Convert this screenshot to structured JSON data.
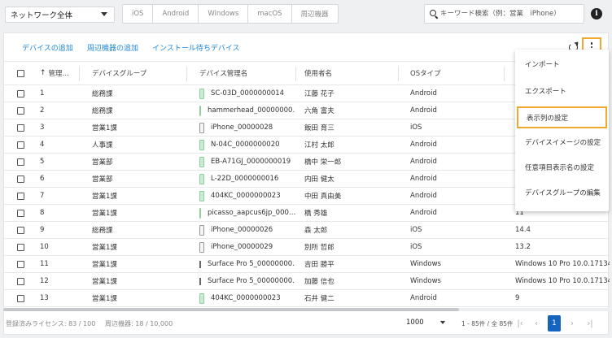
{
  "topbar": {
    "network_select": "ネットワーク全体",
    "os_filters": [
      "iOS",
      "Android",
      "Windows",
      "macOS",
      "周辺機器"
    ],
    "search_placeholder": "キーワード検索（例：営業　iPhone）",
    "info_glyph": "i"
  },
  "actions": {
    "add_device": "デバイスの追加",
    "add_peripheral": "周辺機器の追加",
    "install_waiting": "インストール待ちデバイス"
  },
  "table": {
    "headers": {
      "no": "管理…",
      "group": "デバイスグループ",
      "device_name": "デバイス管理名",
      "user": "使用者名",
      "os_type": "OSタイプ"
    },
    "rows": [
      {
        "no": "1",
        "group": "総務課",
        "icon": "android",
        "device": "SC-03D_0000000014",
        "user": "江藤 花子",
        "os": "Android",
        "osver": ""
      },
      {
        "no": "2",
        "group": "総務課",
        "icon": "android",
        "device": "hammerhead_00000000…",
        "user": "六角 富夫",
        "os": "Android",
        "osver": ""
      },
      {
        "no": "3",
        "group": "営業1課",
        "icon": "ios",
        "device": "iPhone_00000028",
        "user": "飯田 育三",
        "os": "iOS",
        "osver": ""
      },
      {
        "no": "4",
        "group": "人事課",
        "icon": "android",
        "device": "N-04C_0000000020",
        "user": "江村 太郎",
        "os": "Android",
        "osver": ""
      },
      {
        "no": "5",
        "group": "営業部",
        "icon": "android",
        "device": "EB-A71GJ_0000000019",
        "user": "橋中 栄一郎",
        "os": "Android",
        "osver": ""
      },
      {
        "no": "6",
        "group": "営業部",
        "icon": "android",
        "device": "L-22D_0000000016",
        "user": "内田 健太",
        "os": "Android",
        "osver": ""
      },
      {
        "no": "7",
        "group": "営業1課",
        "icon": "android",
        "device": "404KC_0000000023",
        "user": "中田 真由美",
        "os": "Android",
        "osver": ""
      },
      {
        "no": "8",
        "group": "営業1課",
        "icon": "android",
        "device": "picasso_aapcus6jp_000…",
        "user": "橋 秀雄",
        "os": "Android",
        "osver": "11"
      },
      {
        "no": "9",
        "group": "総務課",
        "icon": "ios",
        "device": "iPhone_00000026",
        "user": "森 太郎",
        "os": "iOS",
        "osver": "14.4"
      },
      {
        "no": "10",
        "group": "営業1課",
        "icon": "ios",
        "device": "iPhone_00000029",
        "user": "別所 哲郎",
        "os": "iOS",
        "osver": "13.2"
      },
      {
        "no": "11",
        "group": "営業1課",
        "icon": "win",
        "device": "Surface Pro 5_00000000…",
        "user": "吉田 勝平",
        "os": "Windows",
        "osver": "Windows 10 Pro 10.0.17134"
      },
      {
        "no": "12",
        "group": "営業1課",
        "icon": "win",
        "device": "Surface Pro 5_00000000…",
        "user": "加藤 信也",
        "os": "Windows",
        "osver": "Windows 10 Pro 10.0.17134"
      },
      {
        "no": "13",
        "group": "営業1課",
        "icon": "android",
        "device": "404KC_0000000023",
        "user": "石井 健二",
        "os": "Android",
        "osver": "9"
      }
    ]
  },
  "menu": {
    "items": [
      "インポート",
      "エクスポート",
      "表示列の設定",
      "デバイスイメージの設定",
      "任意項目表示名の設定",
      "デバイスグループの編集"
    ],
    "highlight_color": "#f0a830"
  },
  "footer": {
    "license": "登録済みライセンス: 83 / 100",
    "peripheral": "周辺機器: 18 / 10,000",
    "page_size": "1000",
    "range": "1 - 85件 / 全 85件",
    "current_page": "1"
  },
  "colors": {
    "link": "#1e88d8",
    "accent_outline": "#f0a830",
    "page_active": "#1565c0"
  }
}
